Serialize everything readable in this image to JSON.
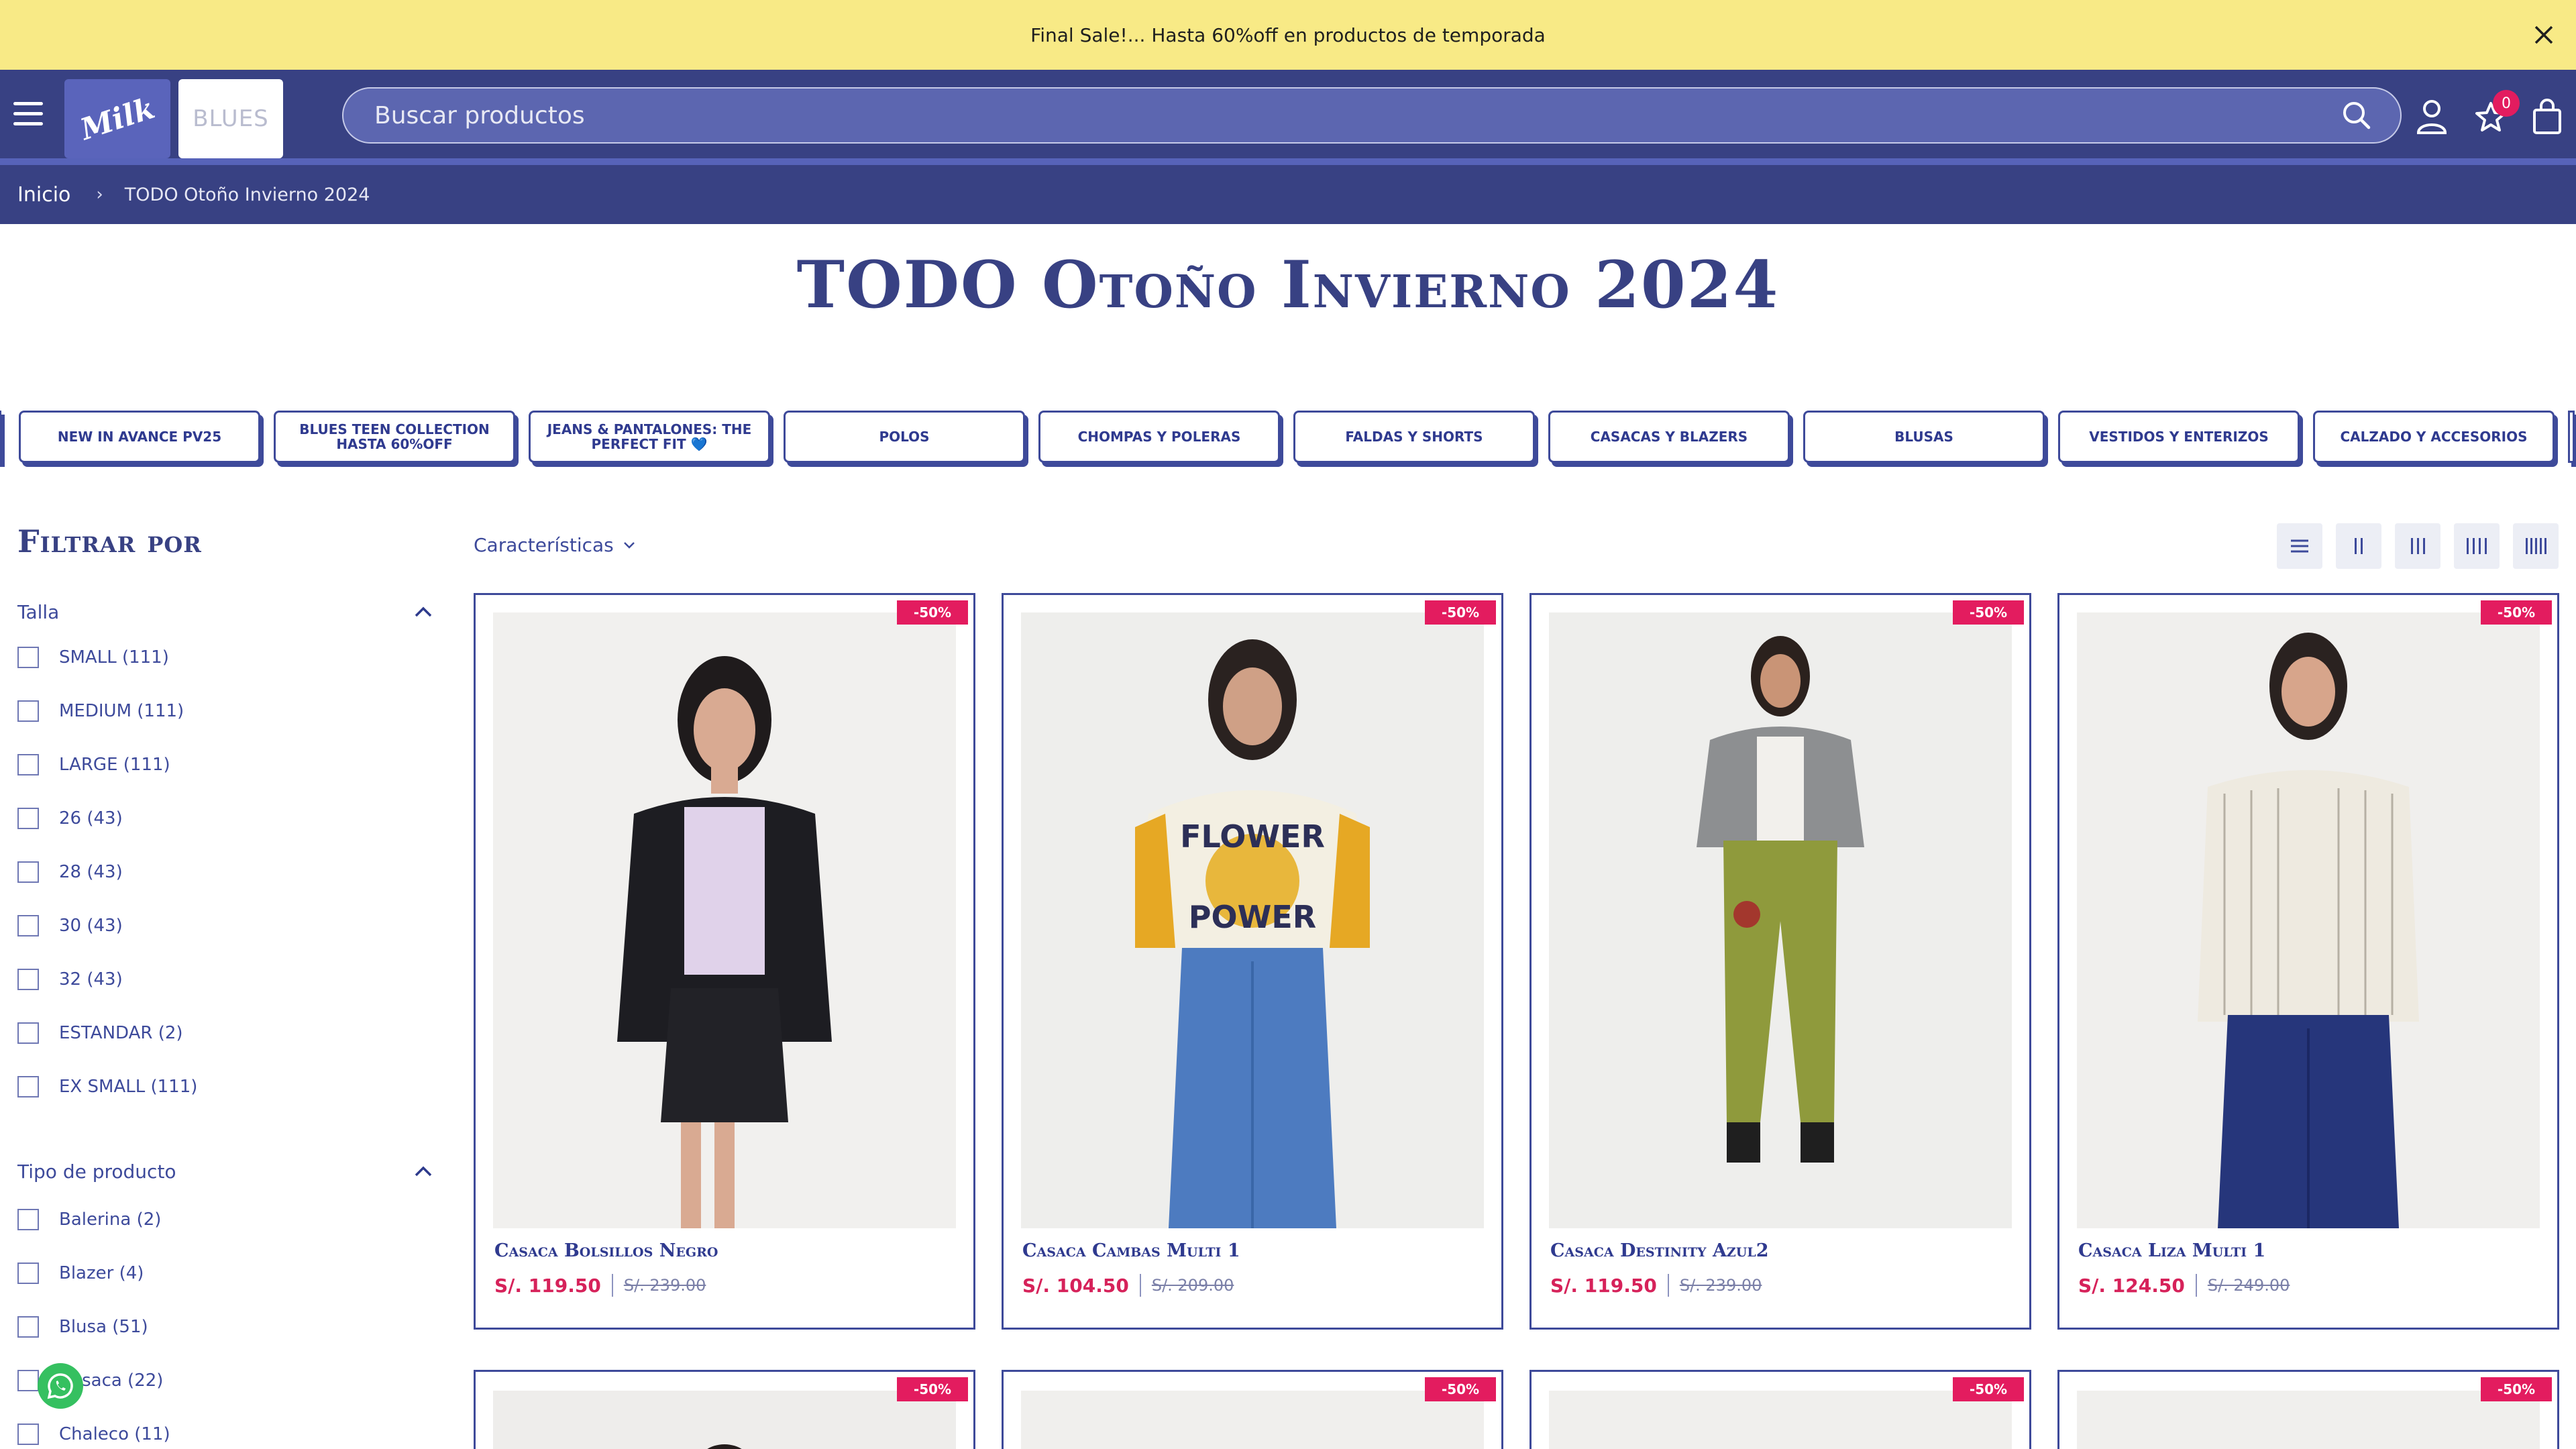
{
  "announcement": {
    "text": "Final Sale!... Hasta 60%off en productos de temporada"
  },
  "header": {
    "logo_text": "Milk",
    "blues_text": "BLUES",
    "search_placeholder": "Buscar productos",
    "wishlist_count": "0"
  },
  "breadcrumb": {
    "home": "Inicio",
    "separator": "›",
    "current": "TODO Otoño Invierno 2024"
  },
  "page_title": "TODO Otoño Invierno 2024",
  "categories": [
    "NEW IN AVANCE PV25",
    "BLUES TEEN COLLECTION HASTA 60%OFF",
    "JEANS & PANTALONES: THE PERFECT FIT 💙",
    "POLOS",
    "CHOMPAS Y POLERAS",
    "FALDAS Y SHORTS",
    "CASACAS Y BLAZERS",
    "BLUSAS",
    "VESTIDOS Y ENTERIZOS",
    "CALZADO Y ACCESORIOS"
  ],
  "filters": {
    "title": "Filtrar por",
    "groups": [
      {
        "label": "Talla",
        "options": [
          "SMALL (111)",
          "MEDIUM (111)",
          "LARGE (111)",
          "26 (43)",
          "28 (43)",
          "30 (43)",
          "32 (43)",
          "ESTANDAR (2)",
          "EX SMALL (111)"
        ]
      },
      {
        "label": "Tipo de producto",
        "options": [
          "Balerina (2)",
          "Blazer (4)",
          "Blusa (51)",
          "Casaca (22)",
          "Chaleco (11)"
        ]
      }
    ]
  },
  "toolbar": {
    "sort_label": "Características"
  },
  "products": [
    {
      "name": "Casaca Bolsillos Negro",
      "price": "S/. 119.50",
      "old_price": "S/. 239.00",
      "discount": "-50%"
    },
    {
      "name": "Casaca Cambas Multi 1",
      "price": "S/. 104.50",
      "old_price": "S/. 209.00",
      "discount": "-50%"
    },
    {
      "name": "Casaca Destinity Azul2",
      "price": "S/. 119.50",
      "old_price": "S/. 239.00",
      "discount": "-50%"
    },
    {
      "name": "Casaca Liza Multi 1",
      "price": "S/. 124.50",
      "old_price": "S/. 249.00",
      "discount": "-50%"
    },
    {
      "discount": "-50%"
    },
    {
      "discount": "-50%"
    },
    {
      "discount": "-50%"
    },
    {
      "discount": "-50%"
    }
  ],
  "colors": {
    "announcement_bg": "#f8ea86",
    "header_bg": "#384183",
    "brand_blue": "#2f3a8f",
    "sale_red": "#e31c5f"
  },
  "icons": [
    "menu-icon",
    "search-icon",
    "user-icon",
    "wishlist-icon",
    "bag-icon",
    "close-icon",
    "chevron-up-icon",
    "whatsapp-icon"
  ]
}
